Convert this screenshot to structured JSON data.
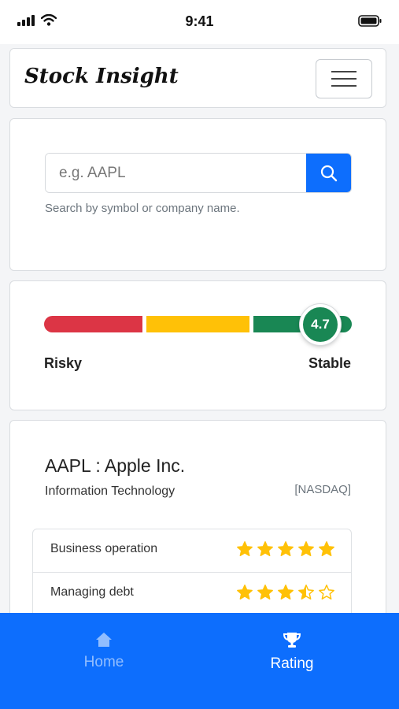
{
  "status_bar": {
    "time": "9:41"
  },
  "navbar": {
    "brand": "Stock Insight"
  },
  "search": {
    "placeholder": "e.g. AAPL",
    "hint": "Search by symbol or company name."
  },
  "meter": {
    "score": "4.7",
    "low_label": "Risky",
    "high_label": "Stable",
    "colors": {
      "risky": "#dc3545",
      "neutral": "#ffc107",
      "stable": "#198754"
    }
  },
  "stock": {
    "title": "AAPL : Apple Inc.",
    "sector": "Information Technology",
    "exchange": "[NASDAQ]",
    "ratings": [
      {
        "label": "Business operation",
        "stars": 5
      },
      {
        "label": "Managing debt",
        "stars": 3.5
      }
    ]
  },
  "bottom_nav": {
    "items": [
      {
        "label": "Home",
        "icon": "home-icon",
        "active": false
      },
      {
        "label": "Rating",
        "icon": "trophy-icon",
        "active": true
      }
    ]
  },
  "colors": {
    "primary": "#0d6efd",
    "star": "#ffc107"
  }
}
